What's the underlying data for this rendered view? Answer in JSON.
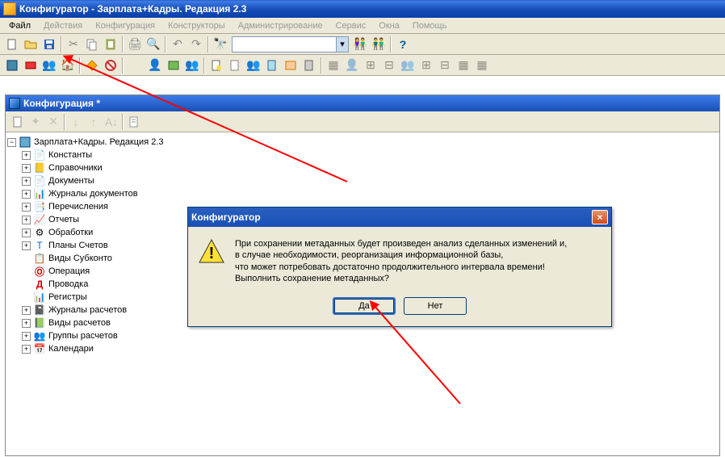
{
  "titlebar": {
    "text": "Конфигуратор - Зарплата+Кадры. Редакция 2.3"
  },
  "menu": {
    "file": "Файл",
    "actions": "Действия",
    "config": "Конфигурация",
    "constructors": "Конструкторы",
    "admin": "Администрирование",
    "service": "Сервис",
    "windows": "Окна",
    "help": "Помощь"
  },
  "subwindow": {
    "title": "Конфигурация *"
  },
  "tree": {
    "root": "Зарплата+Кадры. Редакция 2.3",
    "items": [
      "Константы",
      "Справочники",
      "Документы",
      "Журналы документов",
      "Перечисления",
      "Отчеты",
      "Обработки",
      "Планы Счетов",
      "Виды Субконто",
      "Операция",
      "Проводка",
      "Регистры",
      "Журналы расчетов",
      "Виды расчетов",
      "Группы расчетов",
      "Календари"
    ]
  },
  "dialog": {
    "title": "Конфигуратор",
    "line1": "При сохранении метаданных будет произведен анализ сделанных  изменений и,",
    "line2": "в случае необходимости, реорганизация информационной базы,",
    "line3": "что может потребовать  достаточно продолжительного интервала времени!",
    "line4": "Выполнить сохранение метаданных?",
    "yes": "Да",
    "no": "Нет"
  }
}
